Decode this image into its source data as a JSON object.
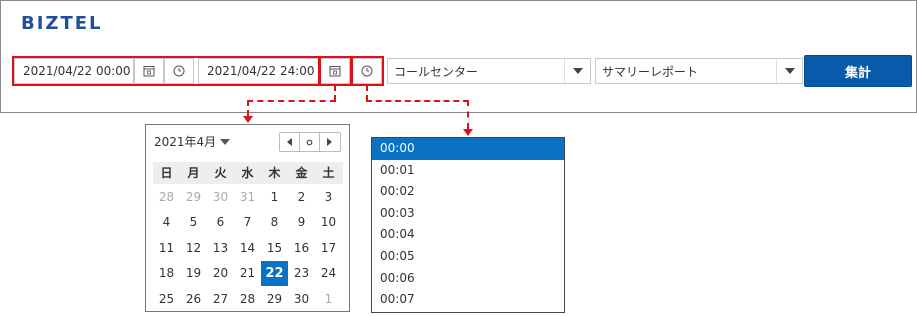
{
  "header": {
    "logo": "BIZTEL"
  },
  "filters": {
    "start_datetime": "2021/04/22 00:00",
    "end_datetime": "2021/04/22 24:00",
    "group_select": "コールセンター",
    "report_select": "サマリーレポート",
    "submit_label": "集計"
  },
  "calendar": {
    "month_label": "2021年4月",
    "weekdays": [
      "日",
      "月",
      "火",
      "水",
      "木",
      "金",
      "土"
    ],
    "weeks": [
      [
        "28",
        "29",
        "30",
        "31",
        "1",
        "2",
        "3"
      ],
      [
        "4",
        "5",
        "6",
        "7",
        "8",
        "9",
        "10"
      ],
      [
        "11",
        "12",
        "13",
        "14",
        "15",
        "16",
        "17"
      ],
      [
        "18",
        "19",
        "20",
        "21",
        "22",
        "23",
        "24"
      ],
      [
        "25",
        "26",
        "27",
        "28",
        "29",
        "30",
        "1"
      ]
    ],
    "muted_first_row": [
      true,
      true,
      true,
      true,
      false,
      false,
      false
    ],
    "muted_last_row": [
      false,
      false,
      false,
      false,
      false,
      false,
      true
    ],
    "selected_day": "22"
  },
  "time_list": {
    "items": [
      "00:00",
      "00:01",
      "00:02",
      "00:03",
      "00:04",
      "00:05",
      "00:06",
      "00:07"
    ],
    "selected": "00:00"
  },
  "colors": {
    "accent": "#0a5aab",
    "selection": "#0a72c4",
    "highlight_red": "#e0101a",
    "logo": "#1f4f9a"
  }
}
